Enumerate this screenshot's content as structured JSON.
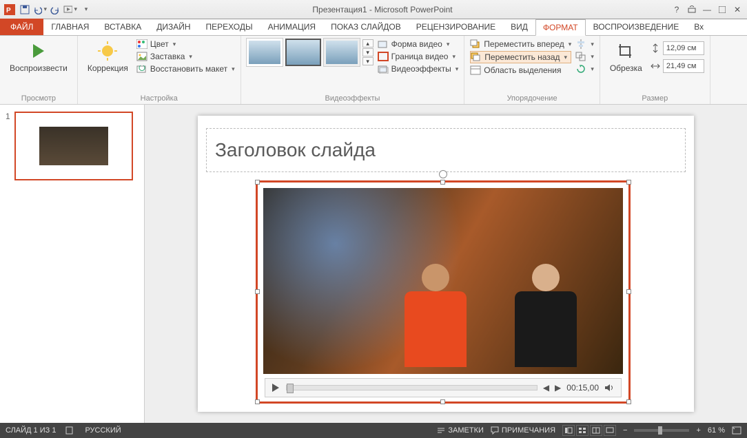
{
  "app": {
    "title": "Презентация1 - Microsoft PowerPoint"
  },
  "tabs": {
    "file": "ФАЙЛ",
    "home": "ГЛАВНАЯ",
    "insert": "ВСТАВКА",
    "design": "ДИЗАЙН",
    "transitions": "ПЕРЕХОДЫ",
    "animations": "АНИМАЦИЯ",
    "slideshow": "ПОКАЗ СЛАЙДОВ",
    "review": "РЕЦЕНЗИРОВАНИЕ",
    "view": "ВИД",
    "format": "ФОРМАТ",
    "playback": "ВОСПРОИЗВЕДЕНИЕ",
    "more": "Вх"
  },
  "ribbon": {
    "preview": {
      "play": "Воспроизвести",
      "group": "Просмотр"
    },
    "adjust": {
      "corrections": "Коррекция",
      "color": "Цвет",
      "poster": "Заставка",
      "reset": "Восстановить макет",
      "group": "Настройка"
    },
    "styles": {
      "shape": "Форма видео",
      "border": "Граница видео",
      "effects": "Видеоэффекты",
      "group": "Видеоэффекты"
    },
    "arrange": {
      "forward": "Переместить вперед",
      "backward": "Переместить назад",
      "selection": "Область выделения",
      "group": "Упорядочение"
    },
    "size": {
      "crop": "Обрезка",
      "height": "12,09 см",
      "width": "21,49 см",
      "group": "Размер"
    }
  },
  "slide": {
    "number": "1",
    "title": "Заголовок слайда"
  },
  "video": {
    "time": "00:15,00"
  },
  "status": {
    "slide": "СЛАЙД 1 ИЗ 1",
    "lang": "РУССКИЙ",
    "notes": "ЗАМЕТКИ",
    "comments": "ПРИМЕЧАНИЯ",
    "zoom": "61 %"
  }
}
